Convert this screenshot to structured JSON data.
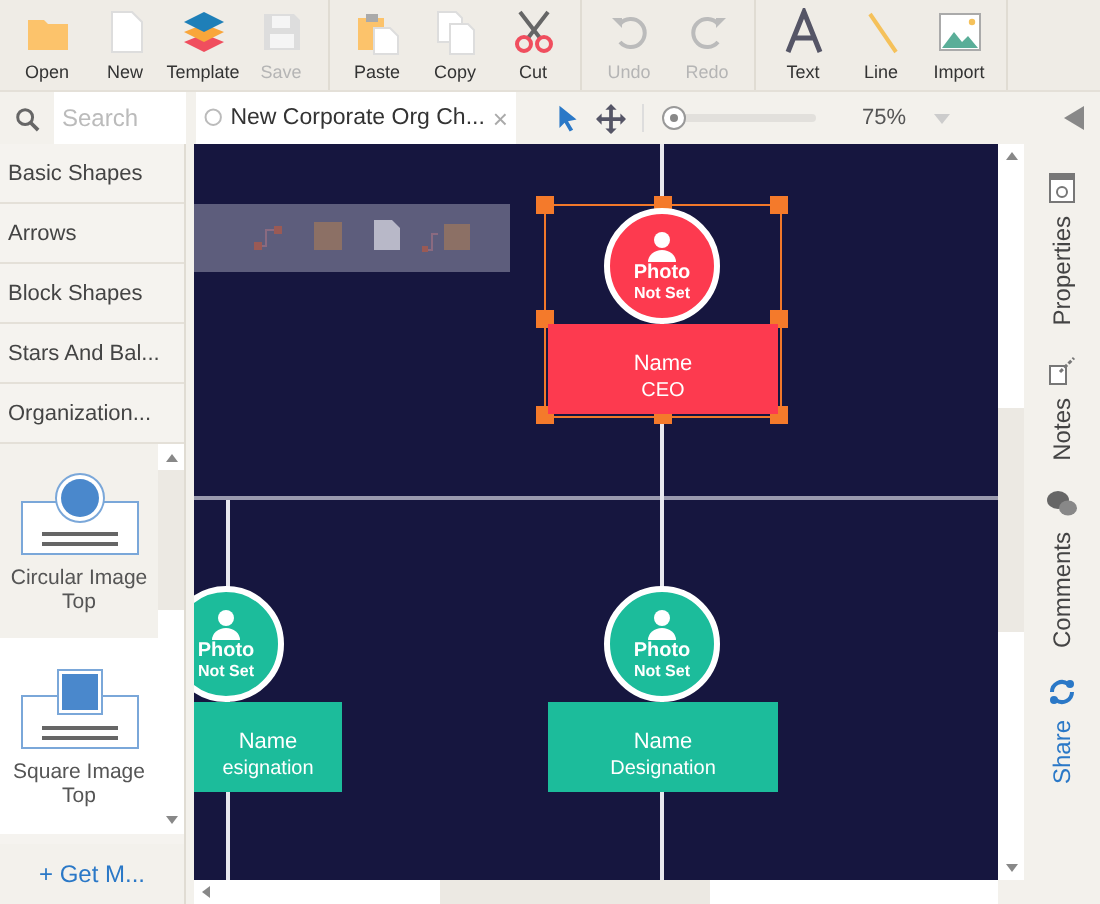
{
  "toolbar_groups": [
    [
      {
        "label": "Open",
        "disabled": false
      },
      {
        "label": "New",
        "disabled": false
      },
      {
        "label": "Template",
        "disabled": false
      },
      {
        "label": "Save",
        "disabled": true
      }
    ],
    [
      {
        "label": "Paste",
        "disabled": false
      },
      {
        "label": "Copy",
        "disabled": false
      },
      {
        "label": "Cut",
        "disabled": false
      }
    ],
    [
      {
        "label": "Undo",
        "disabled": true
      },
      {
        "label": "Redo",
        "disabled": true
      }
    ],
    [
      {
        "label": "Text",
        "disabled": false
      },
      {
        "label": "Line",
        "disabled": false
      },
      {
        "label": "Import",
        "disabled": false
      }
    ]
  ],
  "search": {
    "placeholder": "Search"
  },
  "document_tab": {
    "title": "New Corporate Org Ch...",
    "close": "×"
  },
  "zoom": {
    "level": 0.05,
    "reading": "75%"
  },
  "categories": [
    "Basic Shapes",
    "Arrows",
    "Block Shapes",
    "Stars And Bal...",
    "Organization..."
  ],
  "shapes": [
    {
      "label": "Circular Image Top",
      "kind": "circle",
      "selected": true
    },
    {
      "label": "Square Image Top",
      "kind": "square",
      "selected": false
    }
  ],
  "get_more": "+ Get M...",
  "side_tabs": [
    {
      "label": "Properties",
      "kind": "panel"
    },
    {
      "label": "Notes",
      "kind": "panel"
    },
    {
      "label": "Comments",
      "kind": "panel"
    },
    {
      "label": "Share",
      "kind": "action"
    }
  ],
  "org_chart": {
    "photo": "Photo",
    "photo_note": "Not Set",
    "name": "Name",
    "role": "CEO",
    "color": "#fd3a4f",
    "selected": true,
    "children": [
      {
        "photo": "Photo",
        "photo_note": "Not Set",
        "name": "Name",
        "role": "esignation",
        "color": "#1cbc9b",
        "selected": false
      },
      {
        "photo": "Photo",
        "photo_note": "Not Set",
        "name": "Name",
        "role": "Designation",
        "color": "#1cbc9b",
        "selected": false
      }
    ]
  }
}
